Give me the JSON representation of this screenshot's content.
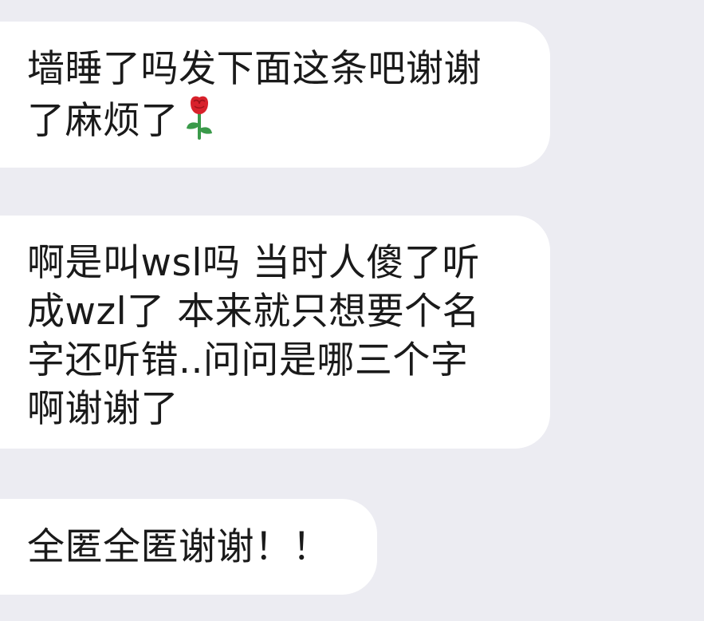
{
  "chat": {
    "messages": [
      {
        "lines": [
          "墙睡了吗发下面这条吧谢谢",
          "了麻烦了"
        ],
        "trailing_icon": "rose-icon"
      },
      {
        "lines": [
          "啊是叫wsl吗 当时人傻了听",
          "成wzl了 本来就只想要个名",
          "字还听错..问问是哪三个字",
          "啊谢谢了"
        ]
      },
      {
        "lines": [
          "全匿全匿谢谢！！"
        ]
      }
    ]
  },
  "colors": {
    "background": "#ececf2",
    "bubble": "#ffffff",
    "text": "#1a1a1a",
    "rose_petal": "#d8212b",
    "rose_leaf": "#3a9a4a"
  }
}
